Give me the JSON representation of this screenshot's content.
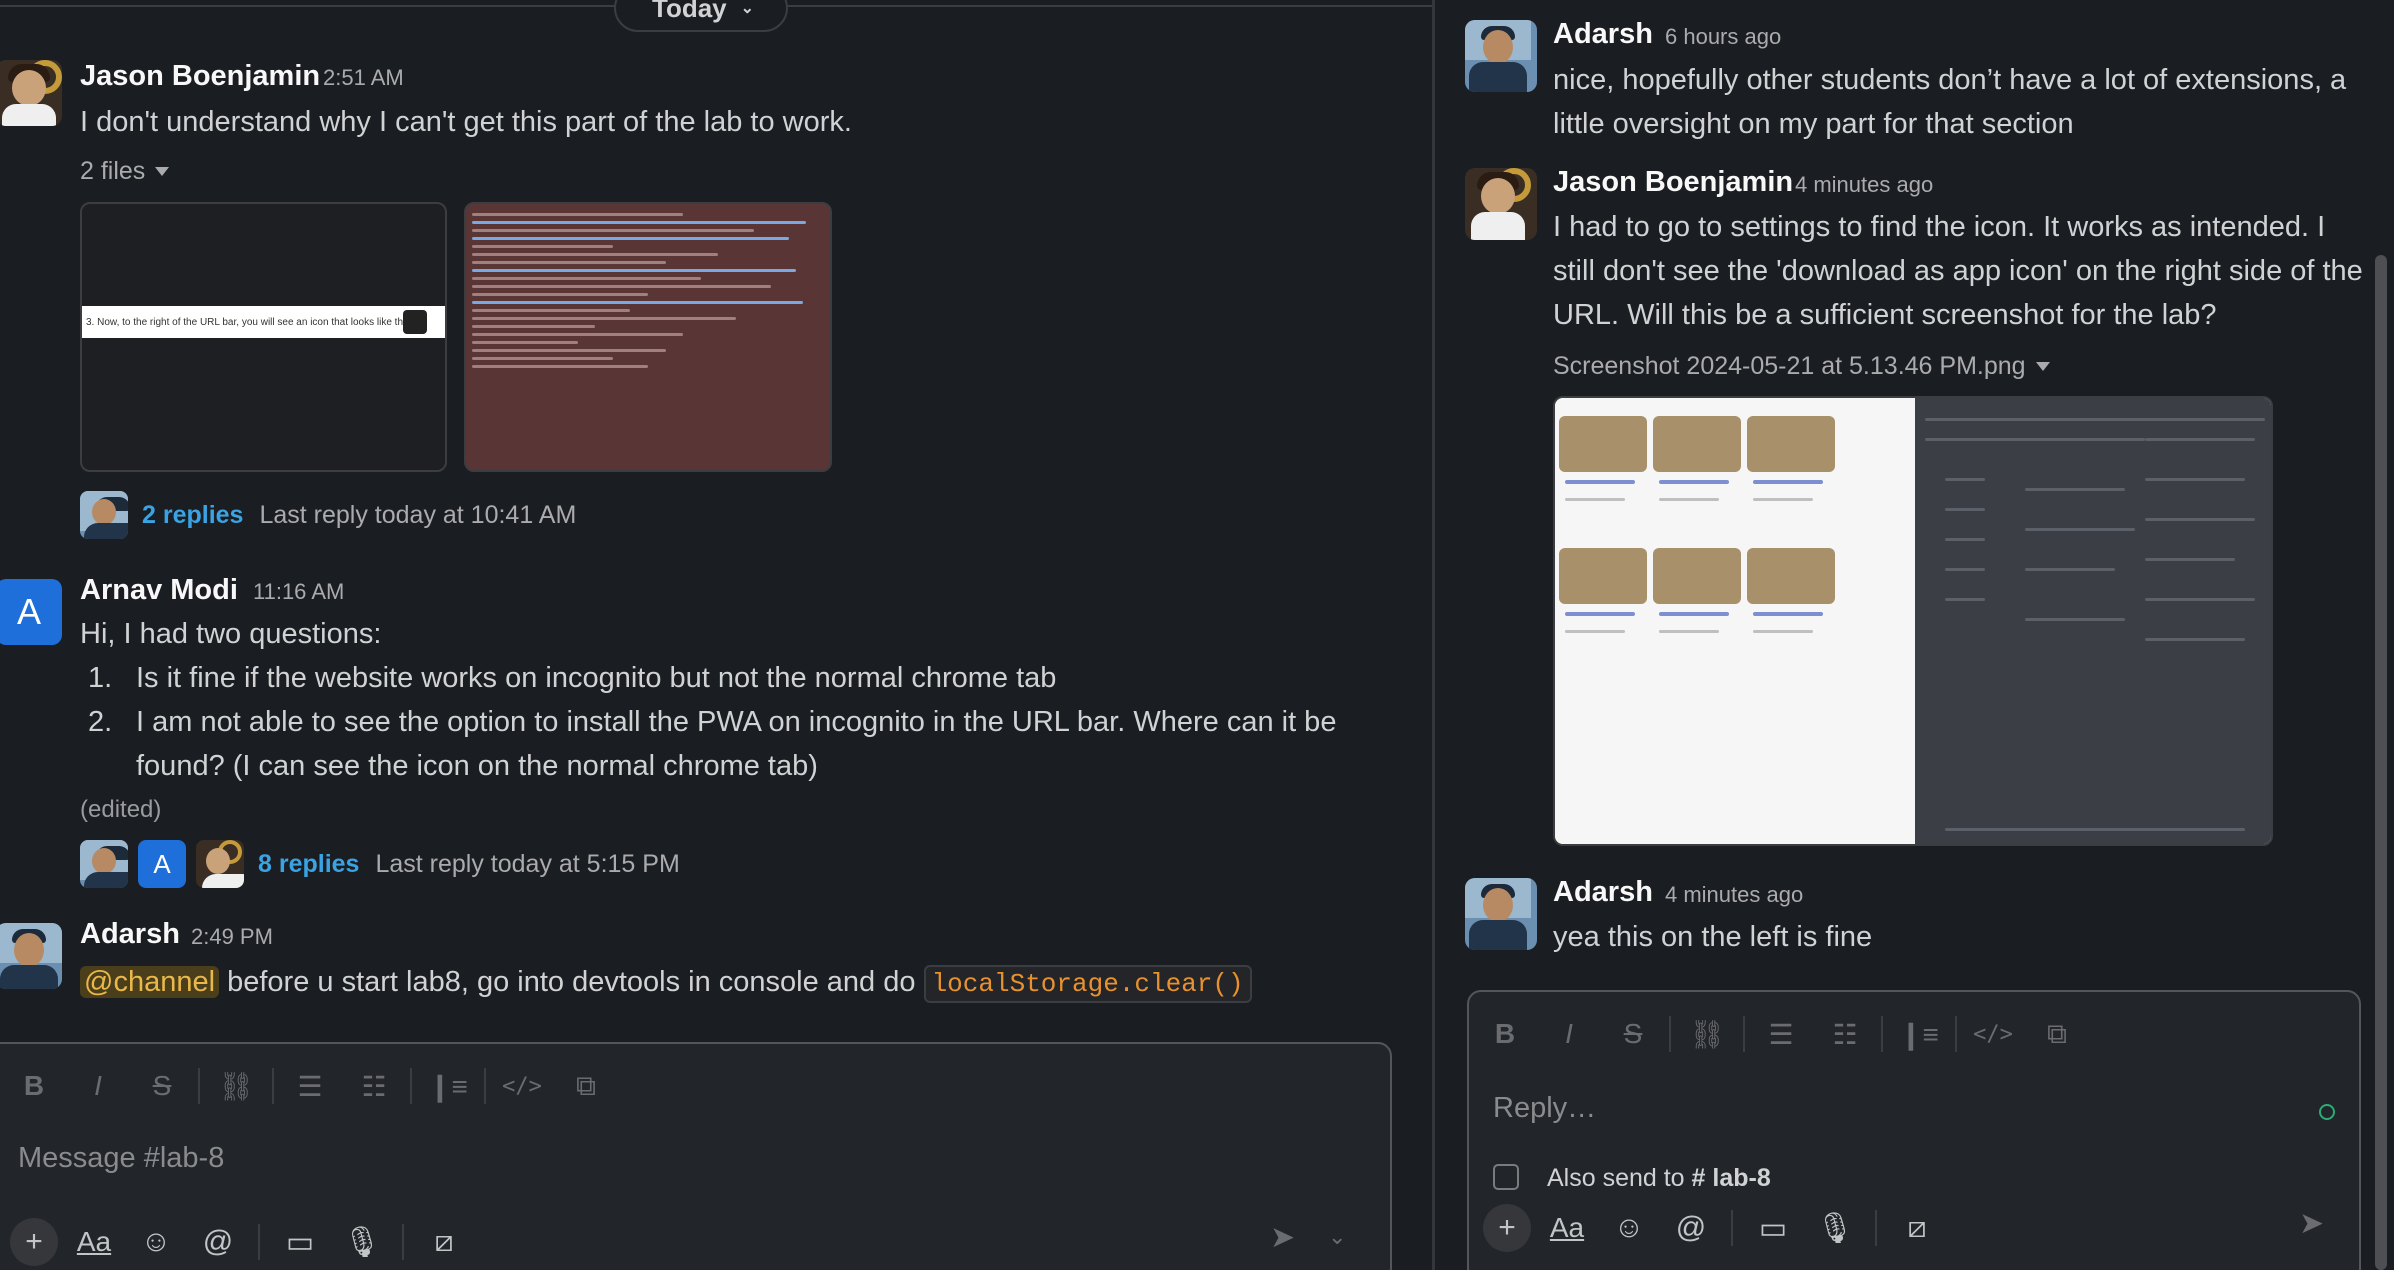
{
  "channel": "lab-8",
  "day_divider": {
    "label": "Today"
  },
  "messages": [
    {
      "author": "Jason Boenjamin",
      "time": "2:51 AM",
      "text": "I don't understand why I can't get this part of the lab to work.",
      "files_label": "2 files",
      "file1_text": "3. Now, to the right of the URL bar, you will see an icon that looks like this:",
      "replies_count": "2 replies",
      "last_reply": "Last reply today at 10:41 AM"
    },
    {
      "author": "Arnav Modi",
      "avatar_letter": "A",
      "time": "11:16 AM",
      "text": "Hi, I had two questions:",
      "list": [
        {
          "num": "1.",
          "text": "Is it fine if the website works on incognito but not the normal chrome tab"
        },
        {
          "num": "2.",
          "text": "I am not able to see the option to install the PWA on incognito in the URL bar. Where can it be found? (I can see the icon on the normal chrome tab)"
        }
      ],
      "edited": "(edited)",
      "replies_count": "8 replies",
      "last_reply": "Last reply today at 5:15 PM",
      "reply_avatar_letter": "A"
    },
    {
      "author": "Adarsh",
      "time": "2:49 PM",
      "mention": "@channel",
      "text": "before u start lab8, go into devtools in console and do",
      "code": "localStorage.clear()"
    }
  ],
  "composer": {
    "placeholder": "Message #lab-8",
    "toolbar": [
      "bold",
      "italic",
      "strikethrough",
      "link",
      "ordered-list",
      "bulleted-list",
      "blockquote",
      "code",
      "code-block"
    ],
    "format_labels": {
      "bold": "B",
      "italic": "I",
      "strike": "S",
      "aa": "Aa"
    }
  },
  "thread": {
    "messages": [
      {
        "author": "Adarsh",
        "time": "6 hours ago",
        "text": "nice, hopefully other students don’t have a lot of extensions, a little oversight on my part for that section"
      },
      {
        "author": "Jason Boenjamin",
        "time": "4 minutes ago",
        "text": "I had to go to settings to find the icon. It works as intended. I still don't see the 'download as app icon' on the right side of the URL. Will this be a sufficient screenshot for the lab?",
        "file_label": "Screenshot 2024-05-21 at 5.13.46 PM.png"
      },
      {
        "author": "Adarsh",
        "time": "4 minutes ago",
        "text": "yea this on the left is fine"
      }
    ],
    "reply": {
      "placeholder": "Reply…",
      "also_send_prefix": "Also send to",
      "also_send_channel": "# lab-8"
    }
  },
  "colors": {
    "background": "#1a1d21",
    "link": "#3aa3e3",
    "mention_bg": "#4a3e1b",
    "mention_fg": "#e8b84a",
    "code": "#e8912d",
    "avatar_arnav": "#1e6fd9",
    "online": "#2bac76"
  }
}
